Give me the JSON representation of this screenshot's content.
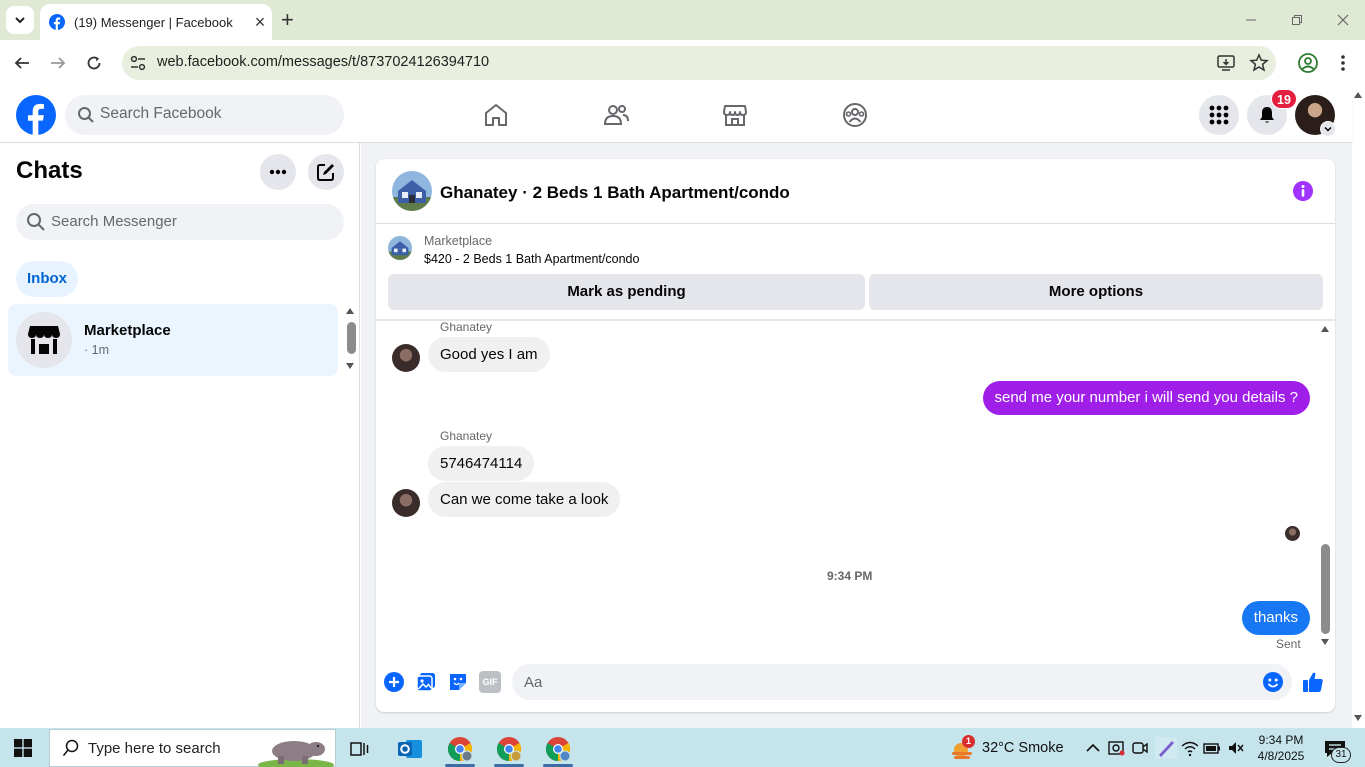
{
  "browser": {
    "tab_title": "(19) Messenger | Facebook",
    "url": "web.facebook.com/messages/t/8737024126394710"
  },
  "facebook": {
    "search_placeholder": "Search Facebook",
    "notification_count": "19"
  },
  "chats": {
    "title": "Chats",
    "search_placeholder": "Search Messenger",
    "filter_label": "Inbox",
    "items": [
      {
        "name": "Marketplace",
        "time": "· 1m"
      }
    ]
  },
  "conversation": {
    "title": "Ghanatey · 2 Beds 1 Bath Apartment/condo",
    "marketplace_label": "Marketplace",
    "listing": "$420 - 2 Beds 1 Bath Apartment/condo",
    "actions": {
      "pending": "Mark as pending",
      "more": "More options"
    },
    "messages": [
      {
        "sender": "Ghanatey",
        "text": "Good yes I am"
      },
      {
        "text": "send me your number i will send you details ?"
      },
      {
        "sender": "Ghanatey",
        "text": "5746474114"
      },
      {
        "text": "Can we come take a look"
      },
      {
        "text": "thanks"
      }
    ],
    "timestamp": "9:34 PM",
    "status": "Sent",
    "input_placeholder": "Aa",
    "gif_label": "GIF"
  },
  "taskbar": {
    "search_placeholder": "Type here to search",
    "weather": "32°C  Smoke",
    "weather_badge": "1",
    "time": "9:34 PM",
    "date": "4/8/2025",
    "notification_count": "31"
  },
  "colors": {
    "fb_blue": "#0866ff",
    "messenger_purple": "#a033ff",
    "sent_bubble_purple": "#9f1fe8",
    "sent_bubble_blue": "#1877f2",
    "notification_red": "#e41e3f"
  }
}
